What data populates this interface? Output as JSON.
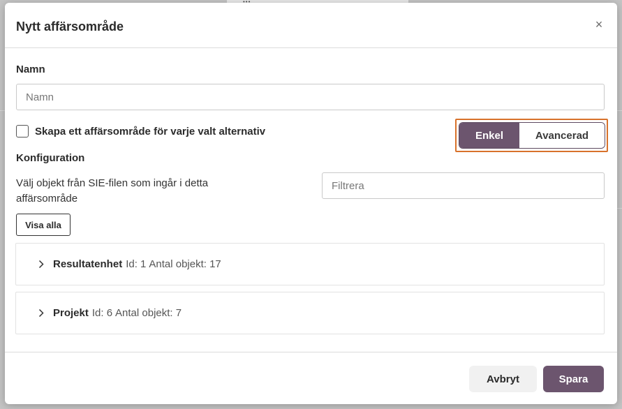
{
  "modal": {
    "title": "Nytt affärsområde",
    "close_label": "×"
  },
  "name_field": {
    "label": "Namn",
    "placeholder": "Namn",
    "value": ""
  },
  "checkbox": {
    "label": "Skapa ett affärsområde för varje valt alternativ",
    "checked": false
  },
  "mode_toggle": {
    "options": [
      "Enkel",
      "Avancerad"
    ],
    "selected": "Enkel"
  },
  "configuration": {
    "title": "Konfiguration",
    "description": "Välj objekt från SIE-filen som ingår i detta affärsområde",
    "filter_placeholder": "Filtrera",
    "show_all_label": "Visa alla"
  },
  "tree_items": [
    {
      "name": "Resultatenhet",
      "id_label": "Id: 1",
      "count_label": "Antal objekt: 17"
    },
    {
      "name": "Projekt",
      "id_label": "Id: 6",
      "count_label": "Antal objekt: 7"
    }
  ],
  "footer": {
    "cancel_label": "Avbryt",
    "save_label": "Spara"
  },
  "colors": {
    "accent": "#6c556e",
    "highlight": "#d8722b"
  }
}
